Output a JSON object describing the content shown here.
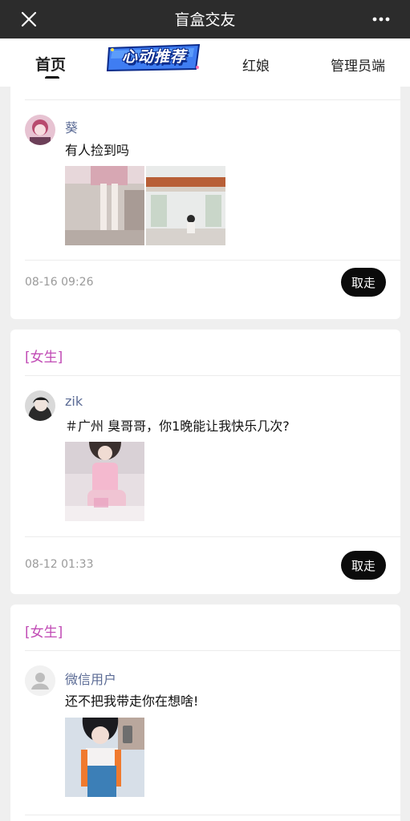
{
  "titlebar": {
    "title": "盲盒交友"
  },
  "nav": {
    "home": "首页",
    "promo": "心动推荐",
    "matchmaker": "红娘",
    "admin": "管理员端"
  },
  "posts": [
    {
      "tag": "",
      "username": "葵",
      "text": "有人捡到吗",
      "time": "08-16 09:26",
      "button": "取走"
    },
    {
      "tag": "[女生]",
      "username": "zik",
      "text": "＃广州 臭哥哥，你1晚能让我快乐几次?",
      "time": "08-12 01:33",
      "button": "取走"
    },
    {
      "tag": "[女生]",
      "username": "微信用户",
      "text": "还不把我带走你在想啥!",
      "time": "",
      "button": ""
    }
  ]
}
